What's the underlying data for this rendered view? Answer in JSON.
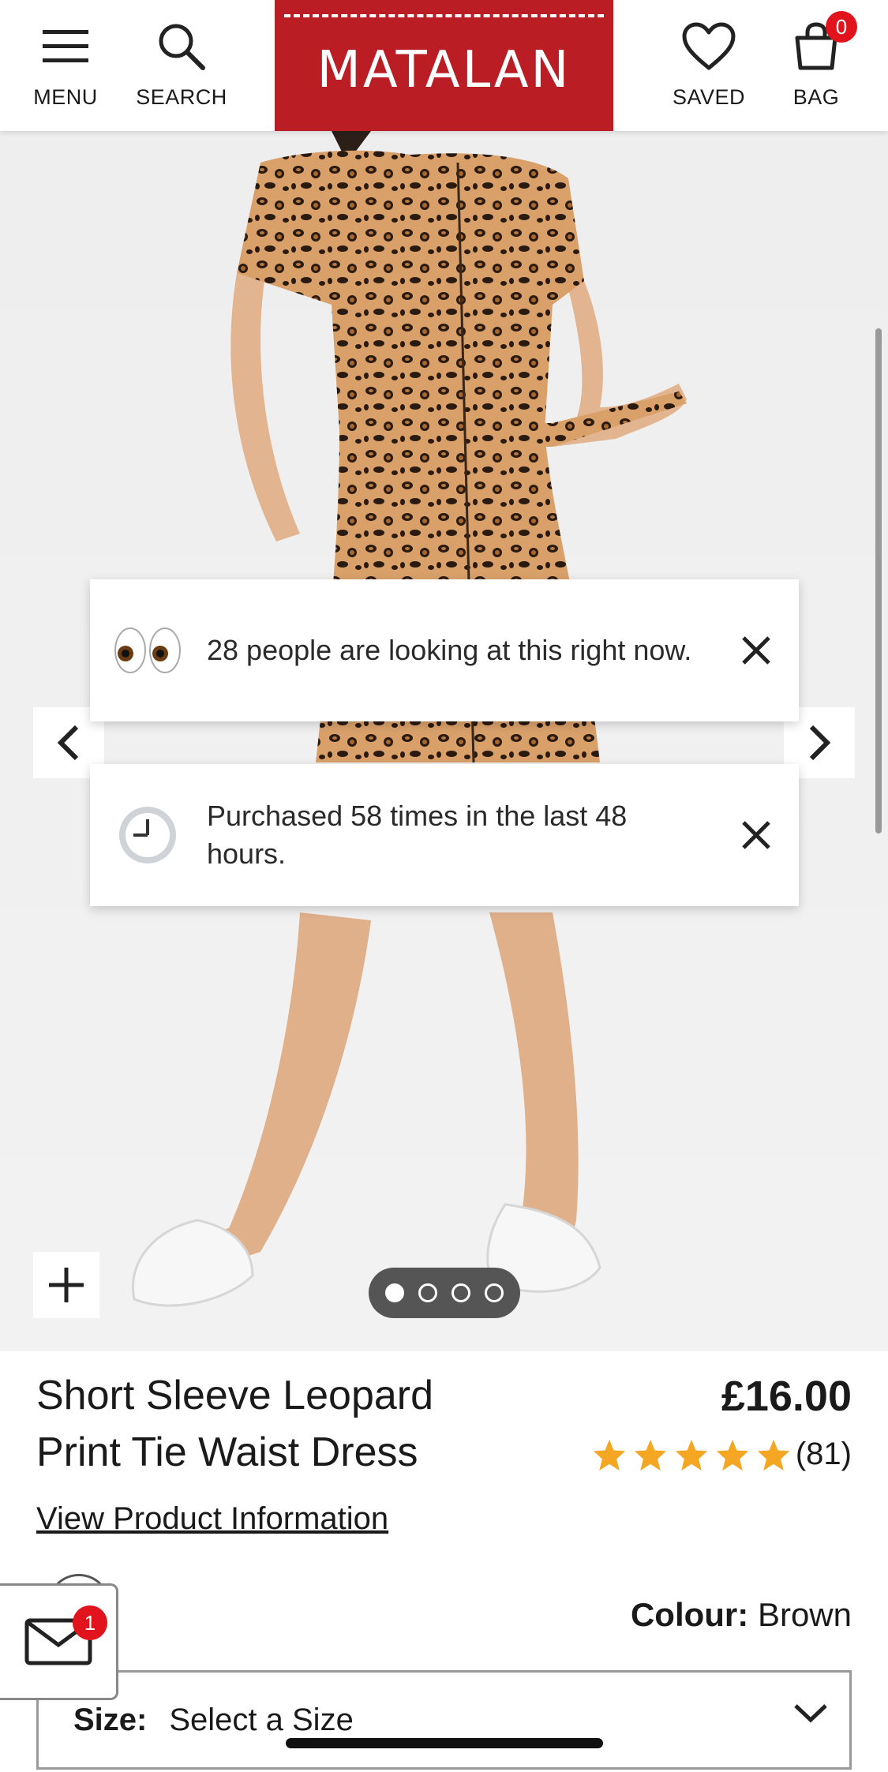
{
  "header": {
    "menu_label": "MENU",
    "search_label": "SEARCH",
    "brand": "MATALAN",
    "saved_label": "SAVED",
    "bag_label": "BAG",
    "bag_count": "0",
    "brand_color": "#ba1d24"
  },
  "gallery": {
    "image_alt": "Model wearing leopard print tie waist dress with white trainers",
    "slide_count": 4,
    "active_slide": 1
  },
  "notifications": [
    {
      "icon": "eyes-icon",
      "text": "28 people are looking at this right now."
    },
    {
      "icon": "clock-icon",
      "text": "Purchased 58 times in the last 48 hours."
    }
  ],
  "product": {
    "title": "Short Sleeve Leopard Print Tie Waist Dress",
    "price": "£16.00",
    "rating_stars": 5,
    "review_count": "(81)",
    "view_info_link": "View Product Information",
    "colour_label": "Colour:",
    "colour_value": "Brown"
  },
  "size_selector": {
    "label": "Size:",
    "value": "Select a Size"
  },
  "mail": {
    "badge_count": "1"
  },
  "colors": {
    "accent_red": "#e1131d",
    "star_color": "#f5a623"
  }
}
